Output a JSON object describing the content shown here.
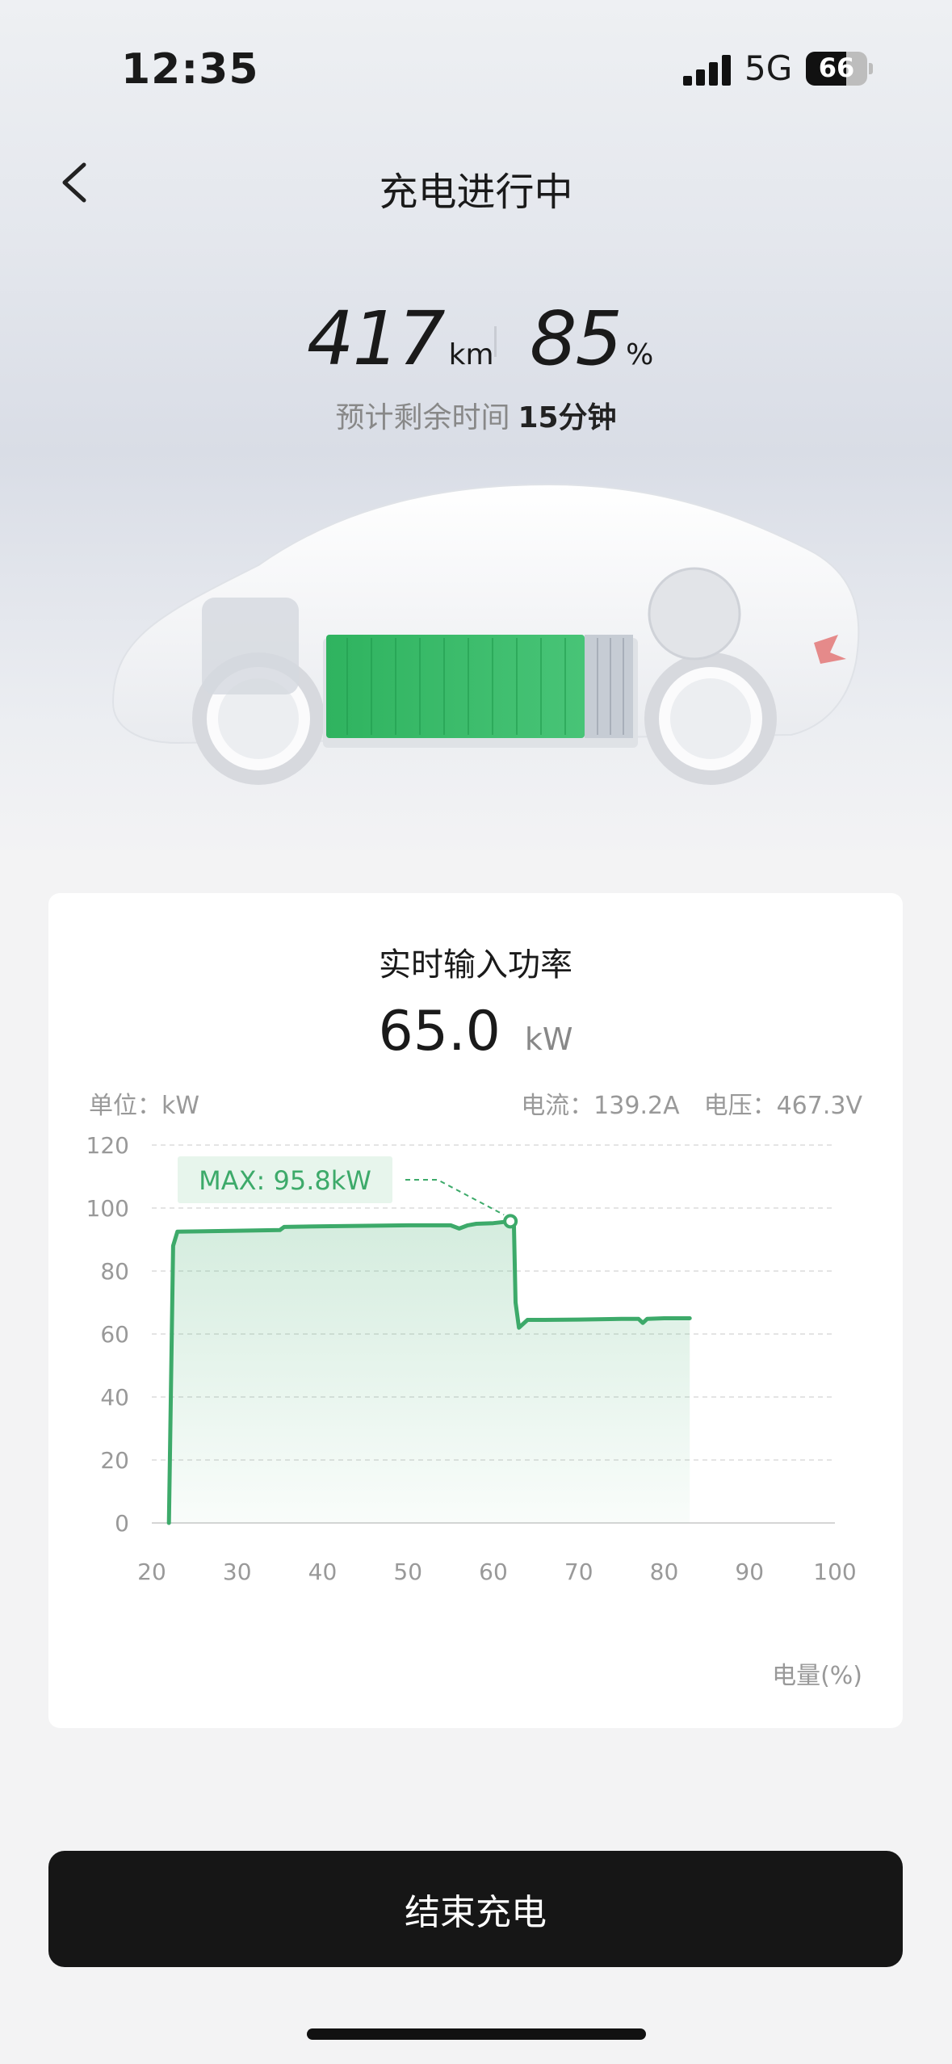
{
  "status_bar": {
    "time": "12:35",
    "network": "5G",
    "battery": "66",
    "battery_level": 0.66
  },
  "nav": {
    "title": "充电进行中",
    "back_icon": "chevron-left-icon"
  },
  "stats": {
    "range_value": "417",
    "range_unit": "km",
    "soc_value": "85",
    "soc_unit": "%",
    "remaining_label": "预计剩余时间",
    "remaining_value": "15分钟"
  },
  "card": {
    "title": "实时输入功率",
    "power_value": "65.0",
    "power_unit": "kW",
    "unit_label": "单位：kW",
    "current_voltage": "电流：139.2A　电压：467.3V",
    "x_axis_title": "电量(%)"
  },
  "chart_data": {
    "type": "area",
    "x": [
      22,
      22.5,
      23,
      30,
      35,
      35.5,
      40,
      50,
      55,
      56,
      57,
      58,
      60,
      62,
      62.4,
      62.6,
      63,
      64,
      66,
      70,
      75,
      77,
      77.5,
      78,
      80,
      83
    ],
    "y": [
      0,
      88,
      92.5,
      92.8,
      93,
      94,
      94.2,
      94.5,
      94.5,
      93.5,
      94.5,
      95,
      95.2,
      95.8,
      95.5,
      70,
      62,
      64.5,
      64.5,
      64.6,
      64.8,
      64.8,
      63.5,
      64.8,
      65,
      65
    ],
    "xlim": [
      20,
      100
    ],
    "ylim": [
      0,
      120
    ],
    "x_ticks": [
      20,
      30,
      40,
      50,
      60,
      70,
      80,
      90,
      100
    ],
    "y_ticks": [
      0,
      20,
      40,
      60,
      80,
      100,
      120
    ],
    "ylabel": "单位：kW",
    "xlabel": "电量(%)",
    "grid": true,
    "line_color": "#3daa6a",
    "annotation": {
      "text": "MAX: 95.8kW",
      "x": 62,
      "y": 95.8
    }
  },
  "actions": {
    "end_label": "结束充电"
  }
}
